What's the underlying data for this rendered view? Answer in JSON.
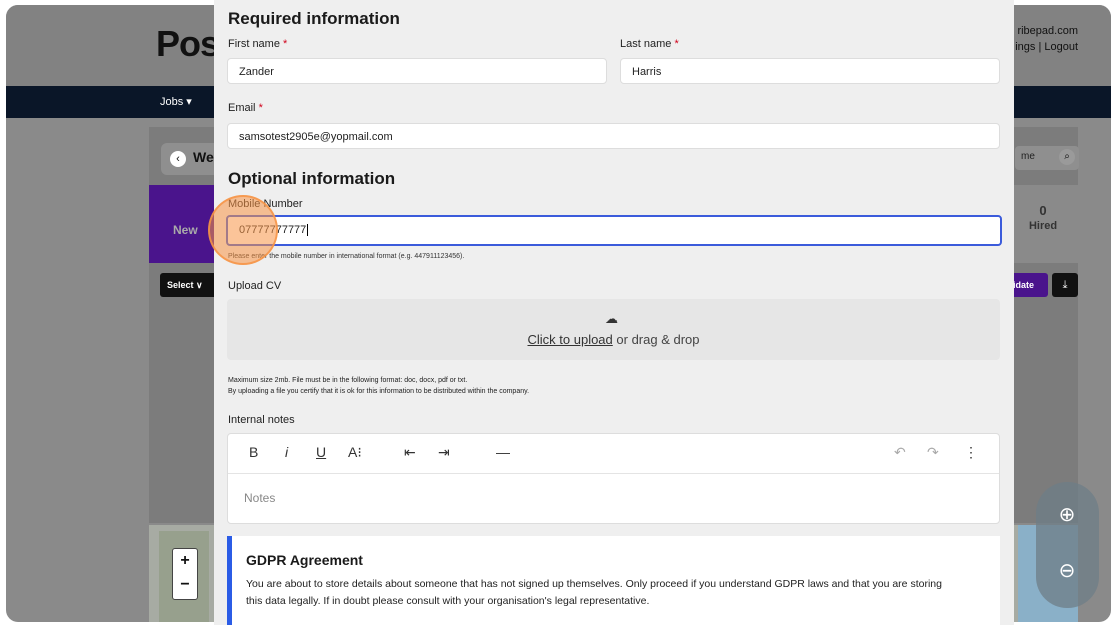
{
  "background": {
    "logo": "Pos",
    "user_line1": "ribepad.com",
    "user_line2": "ings | Logout",
    "nav_jobs": "Jobs ▾",
    "back_label": "We",
    "search_placeholder": "me",
    "stage_new": "New",
    "hired_count": "0",
    "hired_label": "Hired",
    "select_label": "Select ∨",
    "add_candidate_label": "idate"
  },
  "form": {
    "required_title": "Required information",
    "first_name_label": "First name",
    "first_name_value": "Zander",
    "last_name_label": "Last name",
    "last_name_value": "Harris",
    "email_label": "Email",
    "email_value": "samsotest2905e@yopmail.com",
    "required_marker": "*",
    "optional_title": "Optional information",
    "mobile_label": "Mobile Number",
    "mobile_value": "07777777777",
    "mobile_hint": "Please enter the mobile number in international format (e.g. 447911123456).",
    "upload_label": "Upload CV",
    "upload_link": "Click to upload",
    "upload_rest": " or drag & drop",
    "upload_note1": "Maximum size 2mb. File must be in the following format: doc, docx, pdf or txt.",
    "upload_note2": "By uploading a file you certify that it is ok for this information to be distributed within the company.",
    "notes_label": "Internal notes",
    "notes_placeholder": "Notes",
    "gdpr_title": "GDPR Agreement",
    "gdpr_text": "You are about to store details about someone that has not signed up themselves. Only proceed if you understand GDPR laws and that you are storing this data legally. If in doubt please consult with your organisation's legal representative."
  },
  "toolbar": {
    "bold": "B",
    "italic": "i",
    "underline": "U",
    "font_size": "A⁝",
    "outdent": "⇤",
    "indent": "⇥",
    "hr": "—",
    "undo": "↶",
    "redo": "↷",
    "more": "⋮"
  },
  "zoom": {
    "in": "⊕",
    "out": "⊖"
  },
  "colors": {
    "accent": "#3b5bdb",
    "required": "#d0021b",
    "gdpr_bar": "#2b5ce6"
  }
}
